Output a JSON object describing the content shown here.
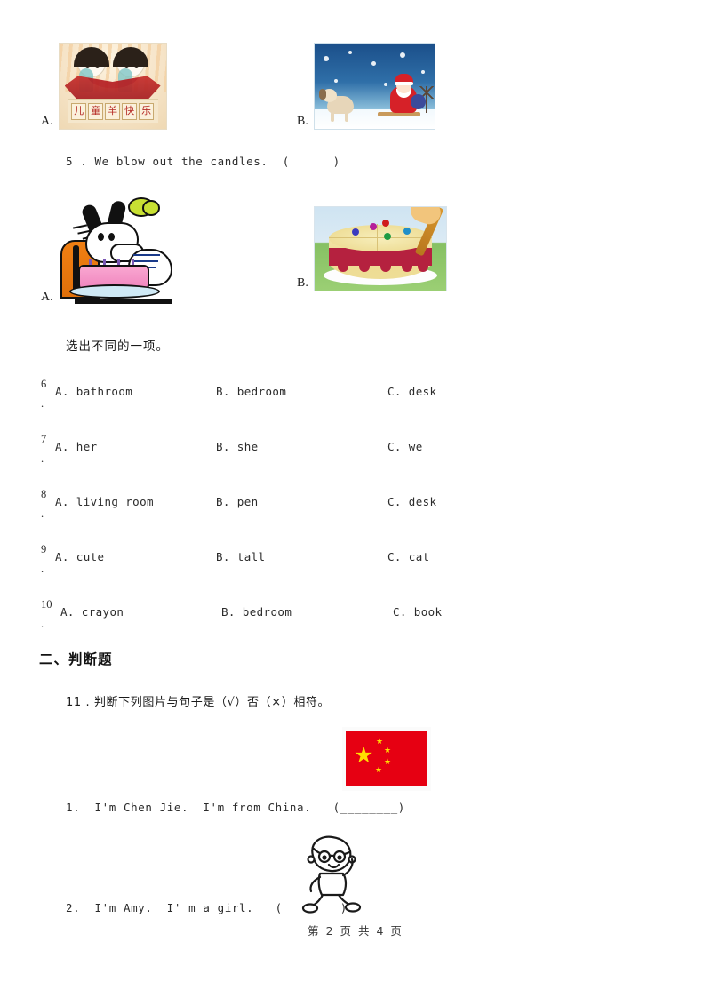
{
  "document": {
    "type": "exam-worksheet",
    "footer": "第 2 页 共 4 页"
  },
  "question4": {
    "options": [
      {
        "label": "A.",
        "image_name": "chinese-new-year-card",
        "image_alt": "Chinese New Year greeting card with two children and red characters",
        "glyphs": [
          "儿",
          "童",
          "羊",
          "快",
          "乐"
        ]
      },
      {
        "label": "B.",
        "image_name": "santa-sleigh-snow",
        "image_alt": "Santa Claus on a sleigh pulled by a dog in snow"
      }
    ]
  },
  "question5": {
    "text": "5 . We blow out the candles.  (      )",
    "options": [
      {
        "label": "A.",
        "image_name": "goofy-blowing-candles",
        "image_alt": "Cartoon dog blowing out candles on a pink cake"
      },
      {
        "label": "B.",
        "image_name": "cake-being-cut",
        "image_alt": "A cake being cut with a knife"
      }
    ]
  },
  "instruction_choose_different": "选出不同的一项。",
  "multiple_choice": {
    "columns": [
      "A",
      "B",
      "C"
    ],
    "rows": [
      {
        "number": "6",
        "dot": ".",
        "a": "A. bathroom",
        "b": "B. bedroom",
        "c": "C. desk"
      },
      {
        "number": "7",
        "dot": ".",
        "a": "A. her",
        "b": "B. she",
        "c": "C. we"
      },
      {
        "number": "8",
        "dot": ".",
        "a": "A. living room",
        "b": "B. pen",
        "c": "C. desk"
      },
      {
        "number": "9",
        "dot": ".",
        "a": "A. cute",
        "b": "B. tall",
        "c": "C. cat"
      },
      {
        "number": "10",
        "dot": ".",
        "a": "A. crayon",
        "b": "B. bedroom",
        "c": "C. book"
      }
    ]
  },
  "section_two": {
    "heading": "二、判断题",
    "question11": "11 . 判断下列图片与句子是（√）否（×）相符。",
    "items": [
      {
        "number": "1.",
        "sentence": "1.  I'm Chen Jie.  I'm from China.   (________)",
        "image_name": "china-flag",
        "image_alt": "Flag of China",
        "flag_color": "#e60012",
        "star_color": "#ffde00"
      },
      {
        "number": "2.",
        "sentence": "2.  I'm Amy.  I' m a girl.   (________)",
        "image_name": "cartoon-boy-line-art",
        "image_alt": "Black and white line drawing of a cartoon boy"
      }
    ]
  }
}
